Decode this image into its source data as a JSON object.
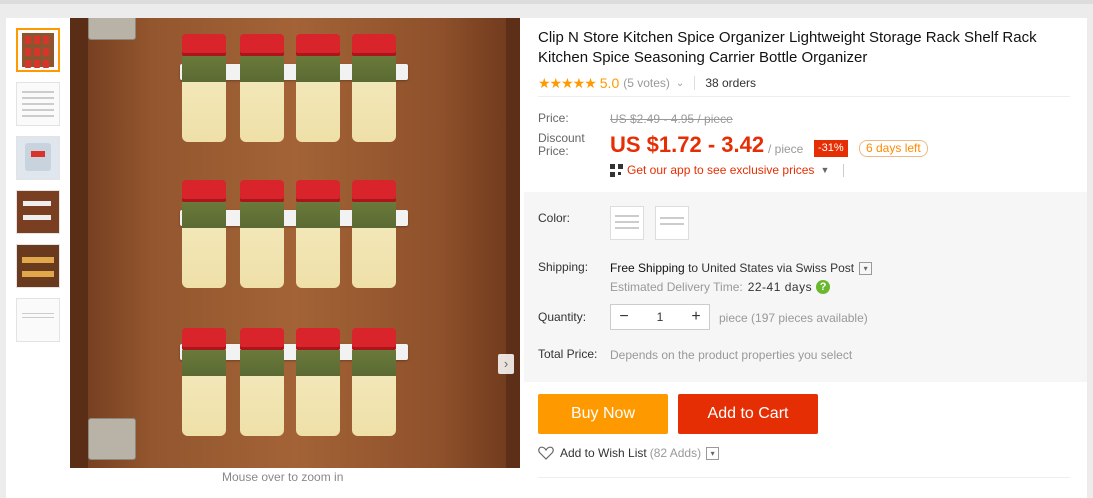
{
  "product": {
    "title": "Clip N Store Kitchen Spice Organizer Lightweight Storage Rack Shelf Rack Kitchen Spice Seasoning Carrier Bottle Organizer",
    "stars": "★★★★★",
    "rating": "5.0",
    "votes": "(5 votes)",
    "orders": "38 orders"
  },
  "pricing": {
    "price_label": "Price:",
    "original_price": "US $2.49 - 4.95 / piece",
    "discount_label_1": "Discount",
    "discount_label_2": "Price:",
    "discount_price": "US $1.72 - 3.42",
    "per_unit": "/ piece",
    "discount_percent": "-31%",
    "days_left": "6 days left",
    "app_promo": "Get our app to see exclusive prices"
  },
  "options": {
    "color_label": "Color:",
    "shipping_label": "Shipping:",
    "shipping_free": "Free Shipping",
    "shipping_to": "to United States via Swiss Post",
    "eta_label": "Estimated Delivery Time:",
    "eta_days": "22-41 days",
    "quantity_label": "Quantity:",
    "quantity_value": "1",
    "availability": "piece (197 pieces available)",
    "total_label": "Total Price:",
    "total_value": "Depends on the product properties you select"
  },
  "actions": {
    "buy_now": "Buy Now",
    "add_to_cart": "Add to Cart",
    "wish_list": "Add to Wish List",
    "wish_count": "(82 Adds)"
  },
  "gallery": {
    "hint": "Mouse over to zoom in"
  },
  "colors": {
    "accent_orange": "#ff9900",
    "price_red": "#e62e04",
    "cap_red": "#d8242a"
  }
}
